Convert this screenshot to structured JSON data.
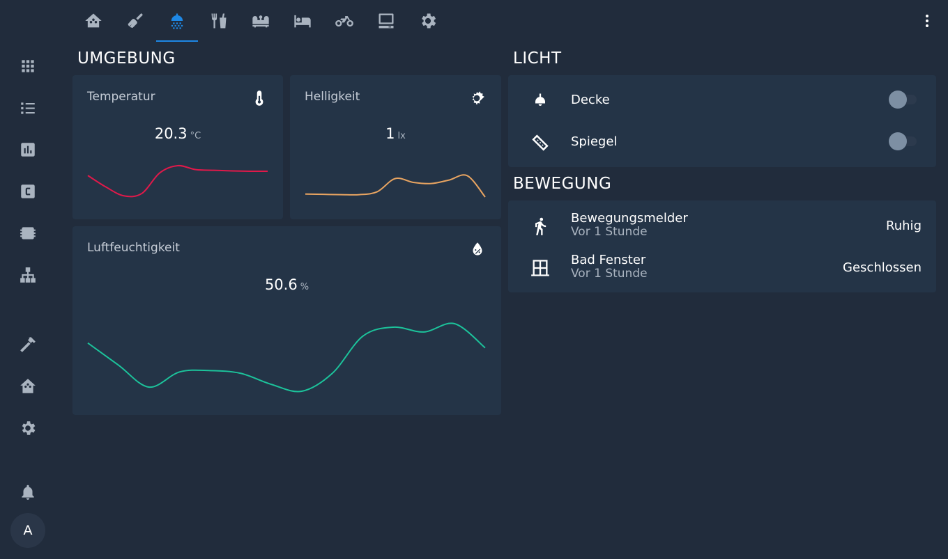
{
  "sidebar": {
    "items": [
      {
        "name": "overview",
        "icon": "view-dashboard-icon",
        "active": true
      },
      {
        "name": "logbook",
        "icon": "format-list-bulleted-icon"
      },
      {
        "name": "history",
        "icon": "chart-box-icon"
      },
      {
        "name": "c-app",
        "icon": "c-box-icon"
      },
      {
        "name": "chip",
        "icon": "chip-icon"
      },
      {
        "name": "network",
        "icon": "sitemap-icon"
      },
      {
        "name": "developer-tools",
        "icon": "hammer-icon"
      },
      {
        "name": "home-assistant",
        "icon": "home-assistant-icon"
      },
      {
        "name": "settings",
        "icon": "gear-icon"
      },
      {
        "name": "notifications",
        "icon": "bell-icon"
      }
    ],
    "avatar_initial": "A"
  },
  "topbar": {
    "tabs": [
      {
        "name": "home",
        "icon": "home-icon"
      },
      {
        "name": "cleaning",
        "icon": "broom-icon"
      },
      {
        "name": "bathroom",
        "icon": "shower-icon",
        "active": true
      },
      {
        "name": "kitchen",
        "icon": "silverware-icon"
      },
      {
        "name": "living",
        "icon": "sofa-icon"
      },
      {
        "name": "bedroom",
        "icon": "bed-icon"
      },
      {
        "name": "garage",
        "icon": "motorbike-icon"
      },
      {
        "name": "office",
        "icon": "desktop-icon"
      },
      {
        "name": "settings",
        "icon": "gear-icon"
      }
    ],
    "more_icon": "dots-vertical-icon"
  },
  "umgebung": {
    "title": "UMGEBUNG",
    "temperatur": {
      "name": "Temperatur",
      "value": "20.3",
      "unit": "°C",
      "icon": "thermometer-icon",
      "color": "#e0194a",
      "trend": [
        0.7,
        0.35,
        0.08,
        0.15,
        0.78,
        1.0,
        0.88,
        0.86,
        0.84,
        0.83,
        0.83
      ]
    },
    "helligkeit": {
      "name": "Helligkeit",
      "value": "1",
      "unit": "lx",
      "icon": "sun-icon",
      "color": "#e8a461",
      "trend": [
        0.22,
        0.21,
        0.2,
        0.2,
        0.3,
        0.75,
        0.62,
        0.58,
        0.7,
        0.85,
        0.12
      ]
    },
    "luftfeuchtigkeit": {
      "name": "Luftfeuchtigkeit",
      "value": "50.6",
      "unit": "%",
      "icon": "water-percent-icon",
      "color": "#1cc39b",
      "trend": [
        0.72,
        0.4,
        0.08,
        0.3,
        0.32,
        0.28,
        0.12,
        0.02,
        0.28,
        0.82,
        0.95,
        0.88,
        1.0,
        0.65
      ]
    }
  },
  "licht": {
    "title": "LICHT",
    "items": [
      {
        "name": "Decke",
        "icon": "ceiling-light-icon",
        "on": false
      },
      {
        "name": "Spiegel",
        "icon": "led-strip-icon",
        "on": false
      }
    ]
  },
  "bewegung": {
    "title": "BEWEGUNG",
    "items": [
      {
        "name": "Bewegungsmelder",
        "sub": "Vor 1 Stunde",
        "state": "Ruhig",
        "icon": "walk-icon"
      },
      {
        "name": "Bad Fenster",
        "sub": "Vor 1 Stunde",
        "state": "Geschlossen",
        "icon": "window-icon"
      }
    ]
  }
}
